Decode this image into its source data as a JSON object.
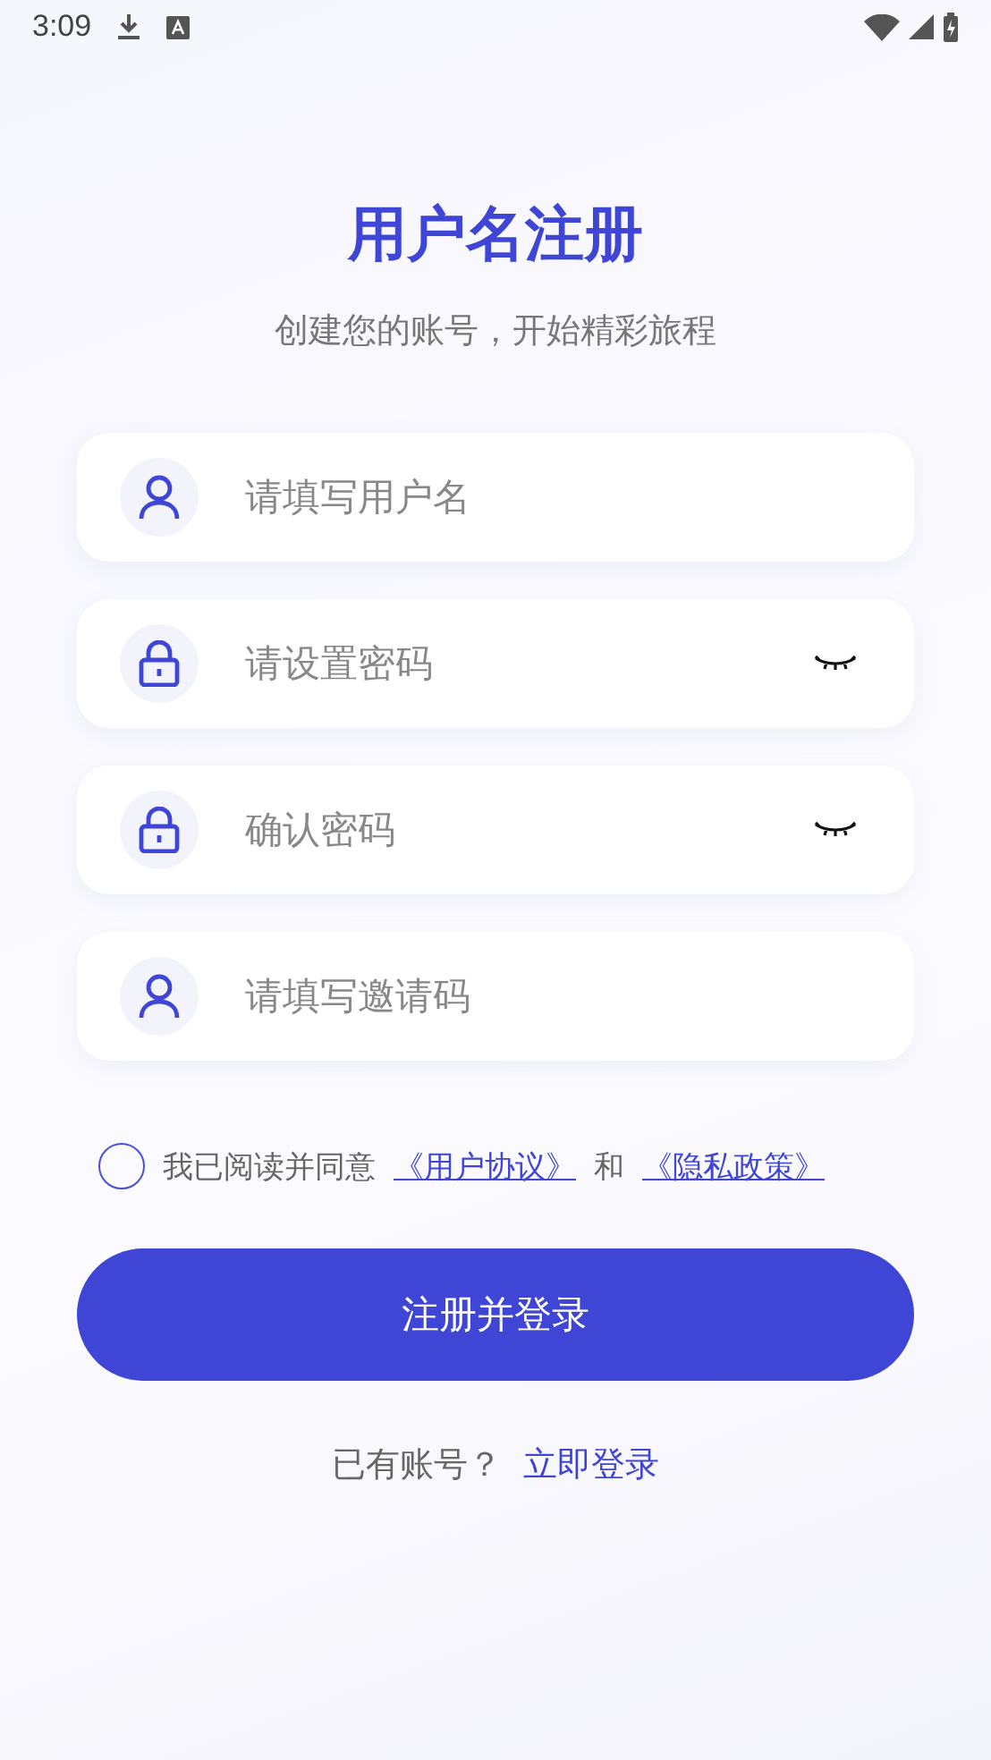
{
  "status_bar": {
    "time": "3:09"
  },
  "title": "用户名注册",
  "subtitle": "创建您的账号，开始精彩旅程",
  "fields": [
    {
      "kind": "text",
      "placeholder": "请填写用户名"
    },
    {
      "kind": "password",
      "placeholder": "请设置密码",
      "masked": true
    },
    {
      "kind": "password",
      "placeholder": "确认密码",
      "masked": true
    },
    {
      "kind": "text",
      "placeholder": "请填写邀请码"
    }
  ],
  "agreement": {
    "checked": false,
    "text": "我已阅读并同意",
    "link_1": "《用户协议》",
    "joiner": "和",
    "link_2": "《隐私政策》"
  },
  "submit_button": "注册并登录",
  "login_prompt": {
    "text": "已有账号？",
    "link": "立即登录"
  }
}
